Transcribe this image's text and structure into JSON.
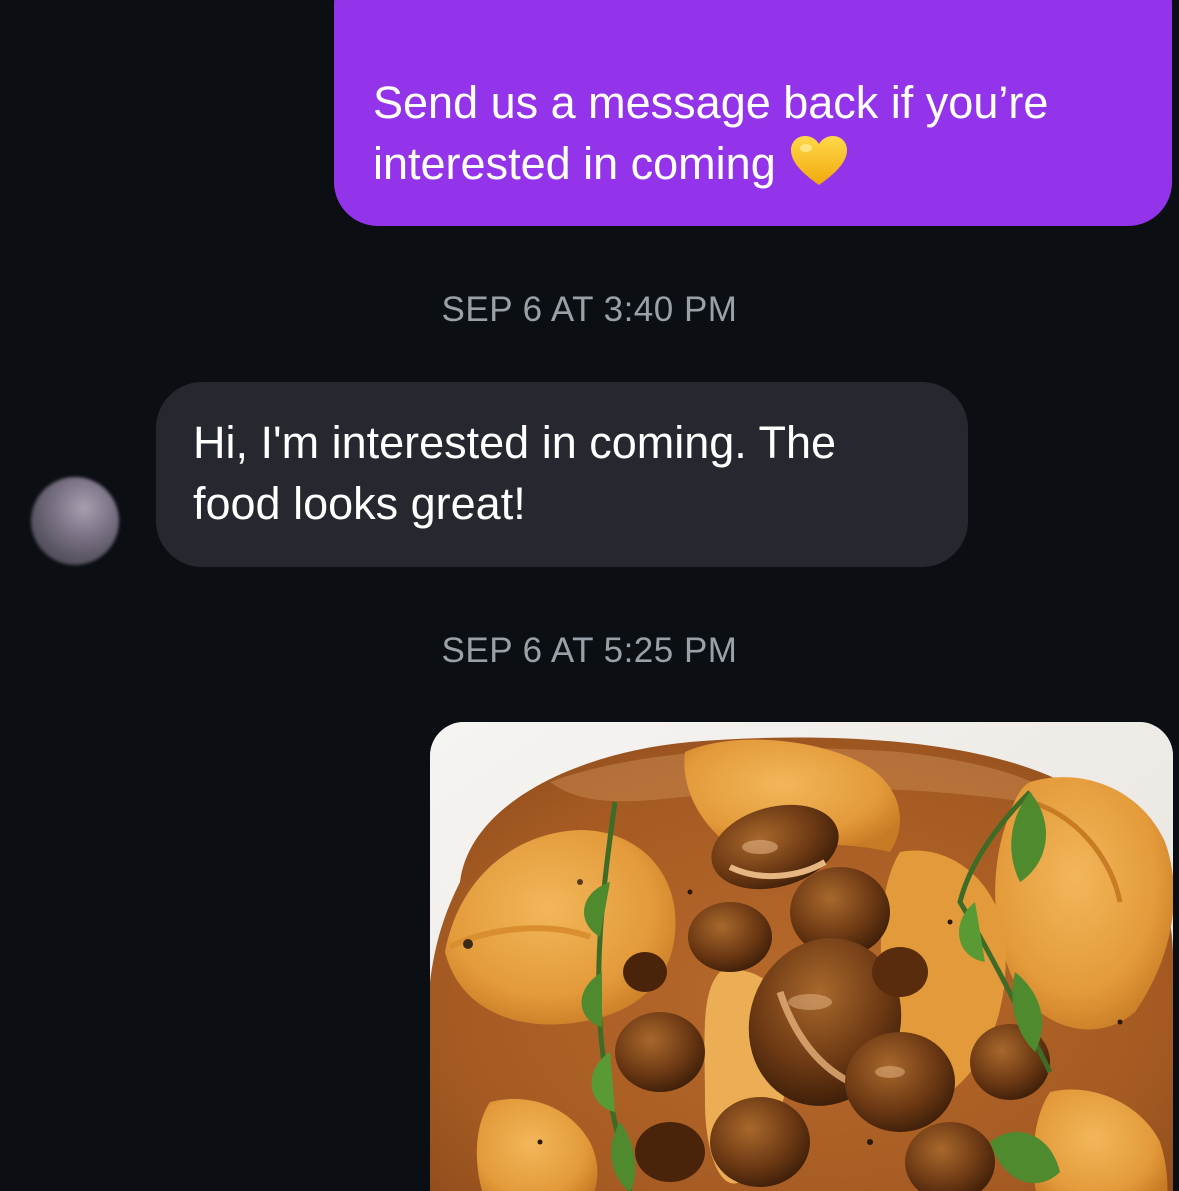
{
  "conversation": {
    "messages": [
      {
        "direction": "outgoing",
        "line1": "Send us a message back if you’re",
        "line2": "interested in coming",
        "emoji": "yellow-heart-icon"
      },
      {
        "direction": "incoming",
        "line1": "Hi, I'm interested in coming. The",
        "line2": "food looks great!"
      }
    ],
    "timestamps": [
      "SEP 6 AT 3:40 PM",
      "SEP 6 AT 5:25 PM"
    ],
    "photo": {
      "subject": "ravioli-with-mushrooms-photo"
    }
  },
  "colors": {
    "background": "#0b0e13",
    "outgoing_bubble": "#9333ea",
    "incoming_bubble": "#25282e",
    "timestamp_text": "#9aa0a8",
    "heart": "#f7c21a"
  }
}
